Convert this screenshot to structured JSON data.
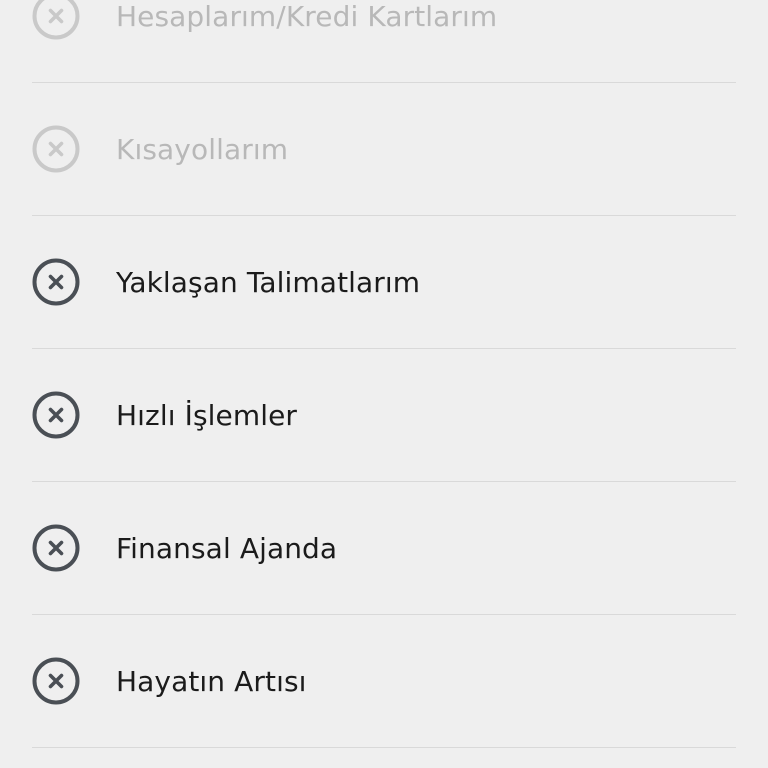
{
  "items": [
    {
      "label": "Hesaplarım/Kredi Kartlarım",
      "enabled": false,
      "icon": "close-circle-icon",
      "icon_color": "#c9c9c9"
    },
    {
      "label": "Kısayollarım",
      "enabled": false,
      "icon": "close-circle-icon",
      "icon_color": "#c9c9c9"
    },
    {
      "label": "Yaklaşan Talimatlarım",
      "enabled": true,
      "icon": "close-circle-icon",
      "icon_color": "#4a4f55"
    },
    {
      "label": "Hızlı İşlemler",
      "enabled": true,
      "icon": "close-circle-icon",
      "icon_color": "#4a4f55"
    },
    {
      "label": "Finansal Ajanda",
      "enabled": true,
      "icon": "close-circle-icon",
      "icon_color": "#4a4f55"
    },
    {
      "label": "Hayatın Artısı",
      "enabled": true,
      "icon": "close-circle-icon",
      "icon_color": "#4a4f55"
    }
  ]
}
